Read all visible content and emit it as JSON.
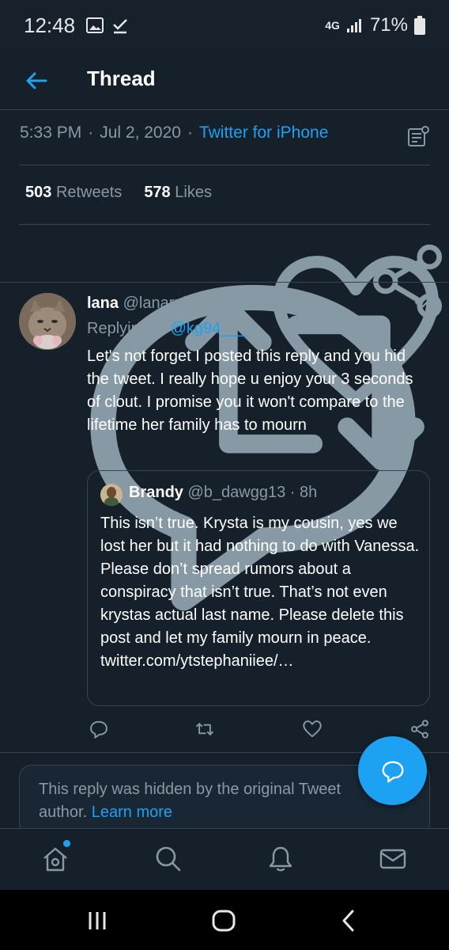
{
  "status_bar": {
    "time": "12:48",
    "network": "4G",
    "battery": "71%"
  },
  "header": {
    "title": "Thread"
  },
  "tweet_meta": {
    "time": "5:33 PM",
    "sep1": "·",
    "date": "Jul 2, 2020",
    "sep2": "·",
    "source": "Twitter for iPhone"
  },
  "stats": {
    "retweets_count": "503",
    "retweets_label": "Retweets",
    "likes_count": "578",
    "likes_label": "Likes"
  },
  "reply": {
    "name": "lana",
    "handle": "@lanarubio",
    "sep": "·",
    "age": "20s",
    "replying_prefix": "Replying to",
    "replying_handle": "@kg94___",
    "text": "Let's not forget I posted this reply and you hid the tweet. I really hope u enjoy your 3 seconds of clout. I promise you it won't compare to the lifetime her family has to mourn"
  },
  "quote": {
    "name": "Brandy",
    "handle": "@b_dawgg13",
    "sep": "·",
    "age": "8h",
    "text": "This isn’t true. Krysta is my cousin, yes we lost her but it had nothing to do with Vanessa. Please don’t spread rumors about a conspiracy that isn’t true. That’s not even krystas actual last name. Please delete this post and let my family mourn in peace. twitter.com/ytstephaniiee/…"
  },
  "hidden_notice": {
    "text": "This reply was hidden by the original Tweet author.",
    "link": "Learn more"
  },
  "icons": {
    "back": "arrow-left-icon",
    "analytics": "analytics-icon",
    "reply": "reply-icon",
    "retweet": "retweet-icon",
    "like": "heart-icon",
    "share": "share-icon",
    "compose": "compose-reply-icon",
    "home": "home-icon",
    "search": "search-icon",
    "notifications": "bell-icon",
    "messages": "mail-icon"
  },
  "colors": {
    "background": "#15202b",
    "accent": "#1da1f2",
    "secondary_text": "#8899a6",
    "border": "#38444d"
  }
}
